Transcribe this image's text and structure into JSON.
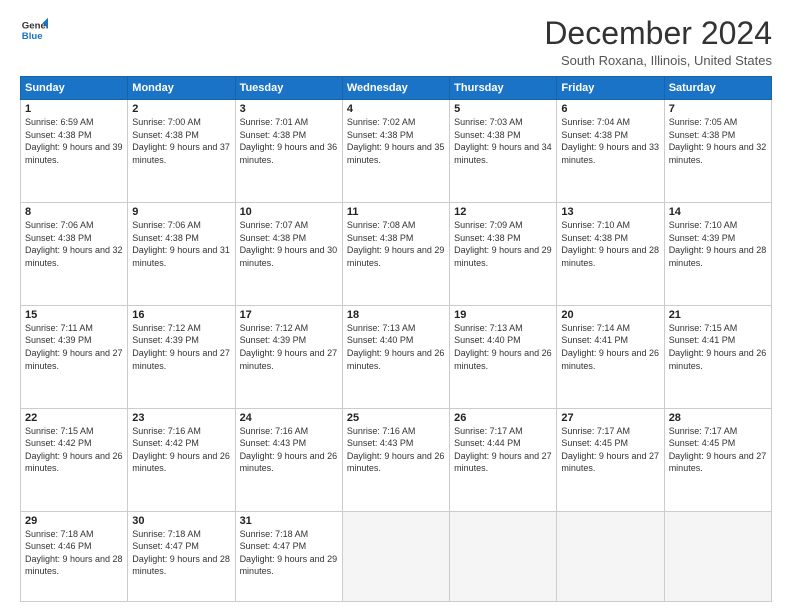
{
  "logo": {
    "line1": "General",
    "line2": "Blue"
  },
  "title": "December 2024",
  "subtitle": "South Roxana, Illinois, United States",
  "days_of_week": [
    "Sunday",
    "Monday",
    "Tuesday",
    "Wednesday",
    "Thursday",
    "Friday",
    "Saturday"
  ],
  "weeks": [
    [
      {
        "day": "1",
        "sunrise": "6:59 AM",
        "sunset": "4:38 PM",
        "daylight": "9 hours and 39 minutes."
      },
      {
        "day": "2",
        "sunrise": "7:00 AM",
        "sunset": "4:38 PM",
        "daylight": "9 hours and 37 minutes."
      },
      {
        "day": "3",
        "sunrise": "7:01 AM",
        "sunset": "4:38 PM",
        "daylight": "9 hours and 36 minutes."
      },
      {
        "day": "4",
        "sunrise": "7:02 AM",
        "sunset": "4:38 PM",
        "daylight": "9 hours and 35 minutes."
      },
      {
        "day": "5",
        "sunrise": "7:03 AM",
        "sunset": "4:38 PM",
        "daylight": "9 hours and 34 minutes."
      },
      {
        "day": "6",
        "sunrise": "7:04 AM",
        "sunset": "4:38 PM",
        "daylight": "9 hours and 33 minutes."
      },
      {
        "day": "7",
        "sunrise": "7:05 AM",
        "sunset": "4:38 PM",
        "daylight": "9 hours and 32 minutes."
      }
    ],
    [
      {
        "day": "8",
        "sunrise": "7:06 AM",
        "sunset": "4:38 PM",
        "daylight": "9 hours and 32 minutes."
      },
      {
        "day": "9",
        "sunrise": "7:06 AM",
        "sunset": "4:38 PM",
        "daylight": "9 hours and 31 minutes."
      },
      {
        "day": "10",
        "sunrise": "7:07 AM",
        "sunset": "4:38 PM",
        "daylight": "9 hours and 30 minutes."
      },
      {
        "day": "11",
        "sunrise": "7:08 AM",
        "sunset": "4:38 PM",
        "daylight": "9 hours and 29 minutes."
      },
      {
        "day": "12",
        "sunrise": "7:09 AM",
        "sunset": "4:38 PM",
        "daylight": "9 hours and 29 minutes."
      },
      {
        "day": "13",
        "sunrise": "7:10 AM",
        "sunset": "4:38 PM",
        "daylight": "9 hours and 28 minutes."
      },
      {
        "day": "14",
        "sunrise": "7:10 AM",
        "sunset": "4:39 PM",
        "daylight": "9 hours and 28 minutes."
      }
    ],
    [
      {
        "day": "15",
        "sunrise": "7:11 AM",
        "sunset": "4:39 PM",
        "daylight": "9 hours and 27 minutes."
      },
      {
        "day": "16",
        "sunrise": "7:12 AM",
        "sunset": "4:39 PM",
        "daylight": "9 hours and 27 minutes."
      },
      {
        "day": "17",
        "sunrise": "7:12 AM",
        "sunset": "4:39 PM",
        "daylight": "9 hours and 27 minutes."
      },
      {
        "day": "18",
        "sunrise": "7:13 AM",
        "sunset": "4:40 PM",
        "daylight": "9 hours and 26 minutes."
      },
      {
        "day": "19",
        "sunrise": "7:13 AM",
        "sunset": "4:40 PM",
        "daylight": "9 hours and 26 minutes."
      },
      {
        "day": "20",
        "sunrise": "7:14 AM",
        "sunset": "4:41 PM",
        "daylight": "9 hours and 26 minutes."
      },
      {
        "day": "21",
        "sunrise": "7:15 AM",
        "sunset": "4:41 PM",
        "daylight": "9 hours and 26 minutes."
      }
    ],
    [
      {
        "day": "22",
        "sunrise": "7:15 AM",
        "sunset": "4:42 PM",
        "daylight": "9 hours and 26 minutes."
      },
      {
        "day": "23",
        "sunrise": "7:16 AM",
        "sunset": "4:42 PM",
        "daylight": "9 hours and 26 minutes."
      },
      {
        "day": "24",
        "sunrise": "7:16 AM",
        "sunset": "4:43 PM",
        "daylight": "9 hours and 26 minutes."
      },
      {
        "day": "25",
        "sunrise": "7:16 AM",
        "sunset": "4:43 PM",
        "daylight": "9 hours and 26 minutes."
      },
      {
        "day": "26",
        "sunrise": "7:17 AM",
        "sunset": "4:44 PM",
        "daylight": "9 hours and 27 minutes."
      },
      {
        "day": "27",
        "sunrise": "7:17 AM",
        "sunset": "4:45 PM",
        "daylight": "9 hours and 27 minutes."
      },
      {
        "day": "28",
        "sunrise": "7:17 AM",
        "sunset": "4:45 PM",
        "daylight": "9 hours and 27 minutes."
      }
    ],
    [
      {
        "day": "29",
        "sunrise": "7:18 AM",
        "sunset": "4:46 PM",
        "daylight": "9 hours and 28 minutes."
      },
      {
        "day": "30",
        "sunrise": "7:18 AM",
        "sunset": "4:47 PM",
        "daylight": "9 hours and 28 minutes."
      },
      {
        "day": "31",
        "sunrise": "7:18 AM",
        "sunset": "4:47 PM",
        "daylight": "9 hours and 29 minutes."
      },
      null,
      null,
      null,
      null
    ]
  ],
  "labels": {
    "sunrise": "Sunrise:",
    "sunset": "Sunset:",
    "daylight": "Daylight:"
  }
}
